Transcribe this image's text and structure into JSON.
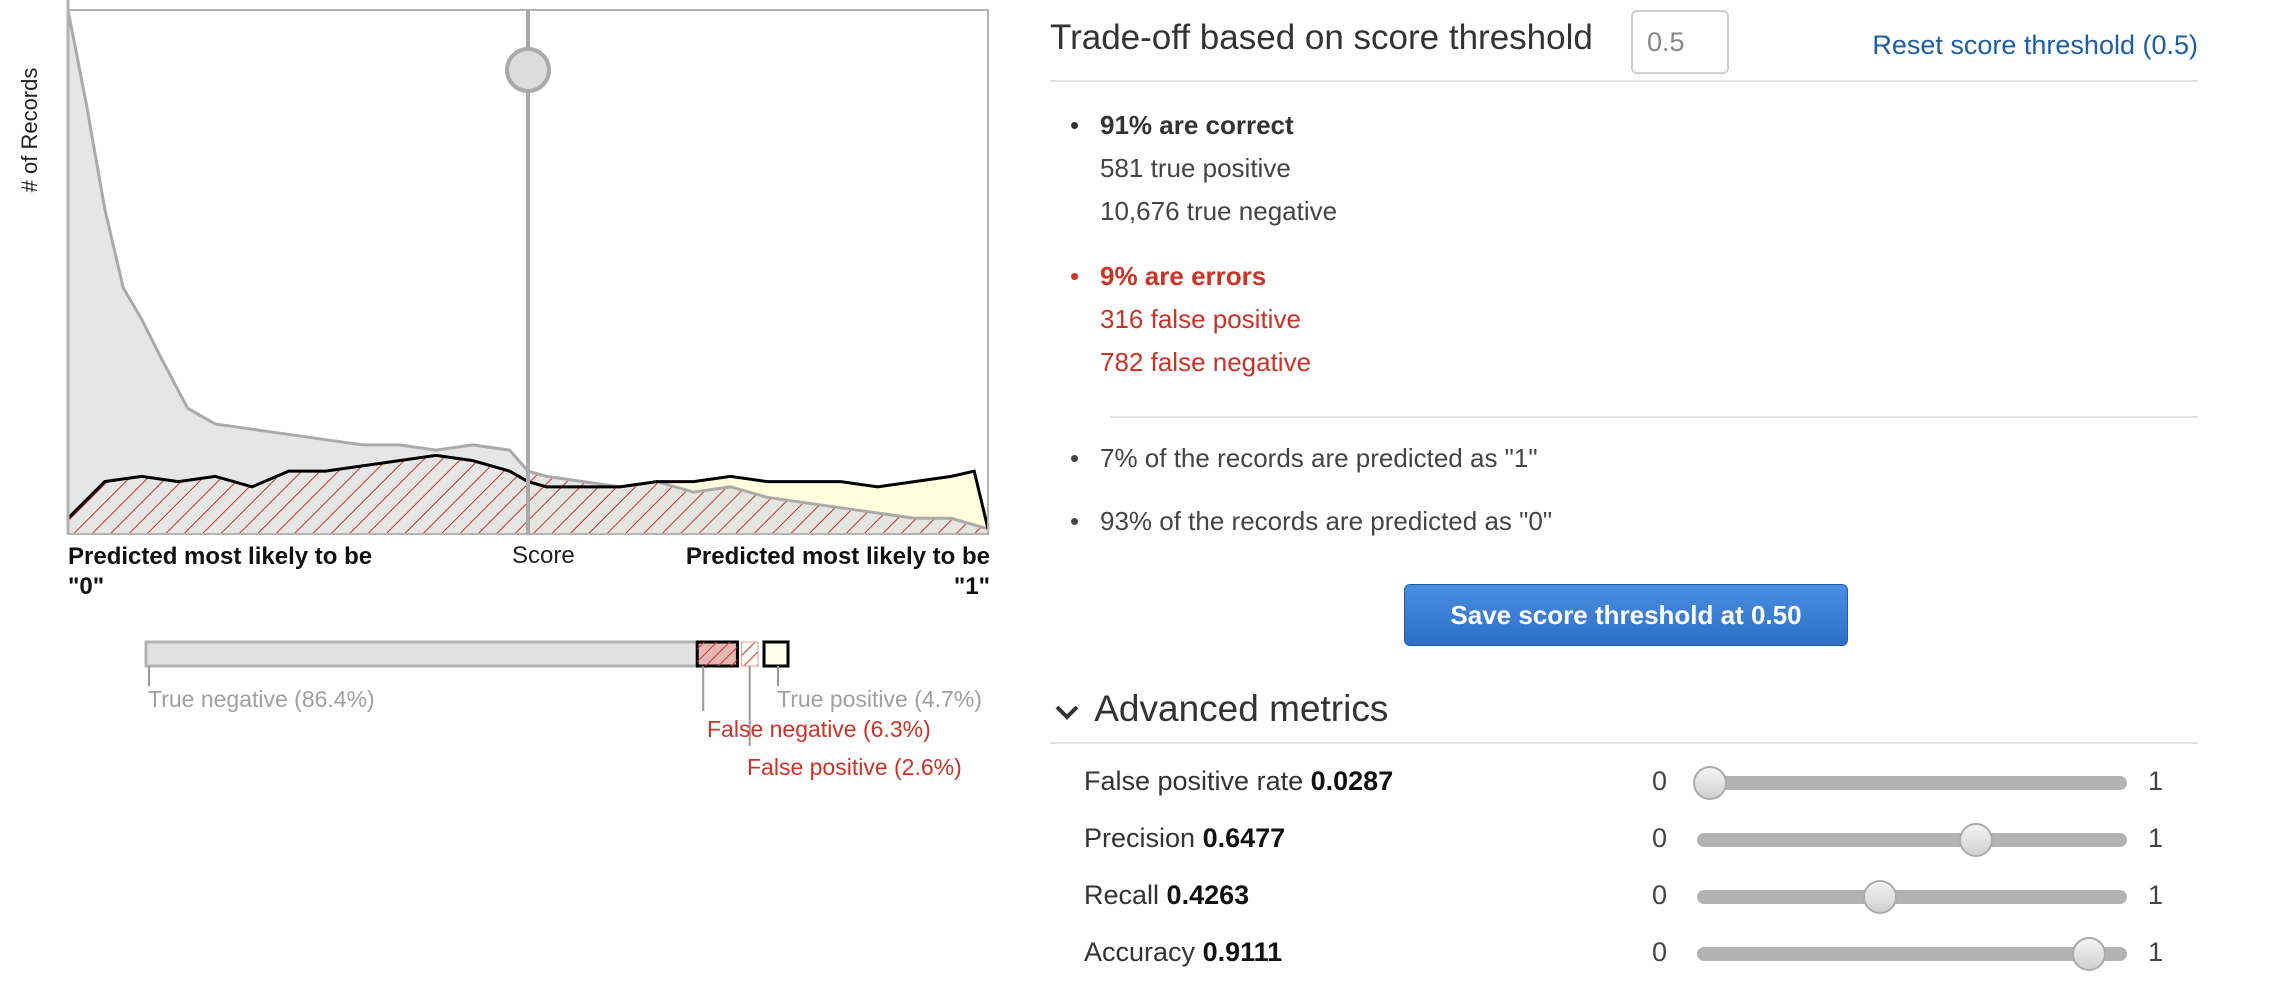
{
  "chart": {
    "y_axis_label": "# of Records",
    "x_axis_label": "Score",
    "x_left_label_l1": "Predicted most likely to be",
    "x_left_label_l2": "\"0\"",
    "x_right_label_l1": "Predicted most likely to be",
    "x_right_label_l2": "\"1\""
  },
  "chart_data": {
    "type": "area",
    "x_range": [
      0,
      1
    ],
    "threshold": 0.5,
    "series": [
      {
        "fill_color": "#e2e2e2",
        "x": [
          0,
          0.02,
          0.04,
          0.06,
          0.08,
          0.1,
          0.13,
          0.16,
          0.2,
          0.24,
          0.28,
          0.32,
          0.36,
          0.4,
          0.44,
          0.48,
          0.5,
          0.52,
          0.56,
          0.6,
          0.64,
          0.68,
          0.72,
          0.76,
          0.8,
          0.84,
          0.88,
          0.92,
          0.96,
          1.0
        ],
        "values": [
          100,
          82,
          62,
          47,
          41,
          34,
          24,
          21,
          20,
          19,
          18,
          17,
          17,
          16,
          17,
          16,
          12,
          11,
          10,
          9,
          10,
          8,
          9,
          7,
          6,
          5,
          4,
          3,
          3,
          1
        ]
      },
      {
        "fill_color": "#ffffdd",
        "x": [
          0,
          0.04,
          0.08,
          0.12,
          0.16,
          0.2,
          0.24,
          0.28,
          0.32,
          0.36,
          0.4,
          0.44,
          0.48,
          0.5,
          0.52,
          0.56,
          0.6,
          0.64,
          0.68,
          0.72,
          0.76,
          0.8,
          0.84,
          0.88,
          0.92,
          0.96,
          0.985,
          1.0
        ],
        "values": [
          3,
          10,
          11,
          10,
          11,
          9,
          12,
          12,
          13,
          14,
          15,
          14,
          12,
          10,
          9,
          9,
          9,
          10,
          10,
          11,
          10,
          10,
          10,
          9,
          10,
          11,
          12,
          1
        ]
      }
    ],
    "confusion_bar": [
      {
        "label": "True negative (86.4%)",
        "share": 0.864,
        "color": "#999999"
      },
      {
        "label": "False negative (6.3%)",
        "share": 0.063,
        "color": "#cc3327"
      },
      {
        "label": "False positive (2.6%)",
        "share": 0.026,
        "color": "#cc3327"
      },
      {
        "label": "True positive (4.7%)",
        "share": 0.047,
        "color": "#999999"
      }
    ]
  },
  "panel": {
    "title": "Trade-off based on score threshold",
    "threshold_value": "0.5",
    "reset_link": "Reset score threshold (0.5)",
    "correct": {
      "headline": "91% are correct",
      "line1": "581 true positive",
      "line2": "10,676 true negative"
    },
    "errors": {
      "headline": "9% are errors",
      "line1": "316 false positive",
      "line2": "782 false negative"
    },
    "predicted_1": "7% of the records are predicted as \"1\"",
    "predicted_0": "93% of the records are predicted as \"0\"",
    "save_button": "Save score threshold at 0.50",
    "advanced_header": "Advanced metrics",
    "metrics": [
      {
        "name": "False positive rate",
        "value": "0.0287",
        "level": 0.0287,
        "min_label": "0",
        "max_label": "1"
      },
      {
        "name": "Precision",
        "value": "0.6477",
        "level": 0.6477,
        "min_label": "0",
        "max_label": "1"
      },
      {
        "name": "Recall",
        "value": "0.4263",
        "level": 0.4263,
        "min_label": "0",
        "max_label": "1"
      },
      {
        "name": "Accuracy",
        "value": "0.9111",
        "level": 0.9111,
        "min_label": "0",
        "max_label": "1"
      }
    ],
    "colors": {
      "link": "#1a5ea8",
      "error": "#cc3327",
      "button": "#2d6fc8"
    }
  }
}
